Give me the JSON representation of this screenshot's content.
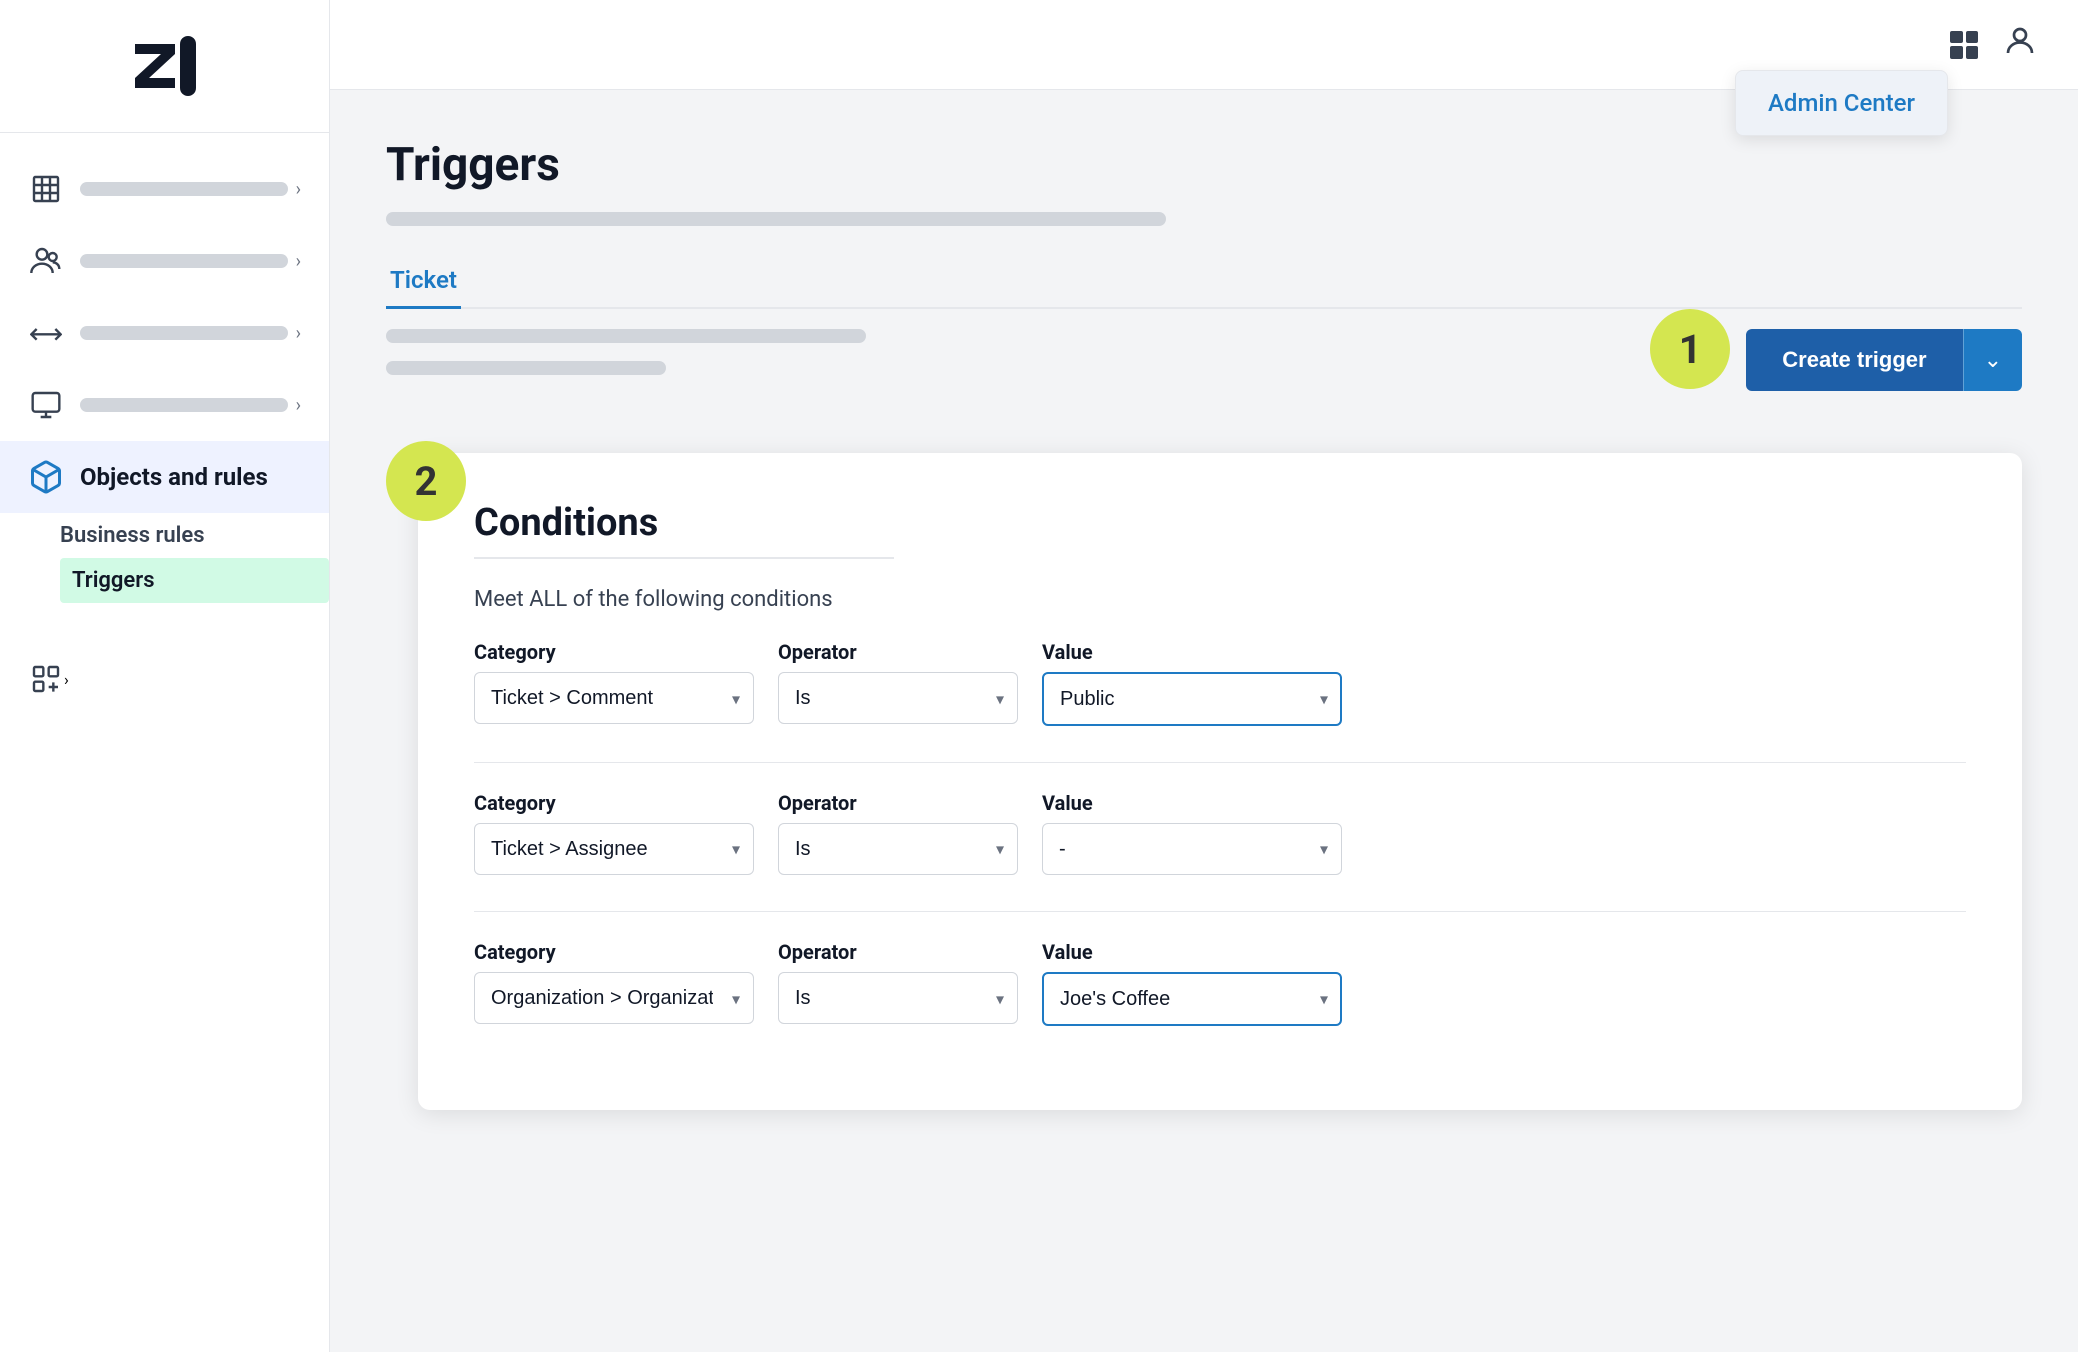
{
  "sidebar": {
    "nav_items": [
      {
        "id": "buildings",
        "icon": "building",
        "active": false
      },
      {
        "id": "people",
        "icon": "people",
        "active": false
      },
      {
        "id": "arrows",
        "icon": "arrows",
        "active": false
      },
      {
        "id": "monitor",
        "icon": "monitor",
        "active": false
      },
      {
        "id": "objects",
        "icon": "objects",
        "label": "Objects and rules",
        "active": true
      },
      {
        "id": "apps",
        "icon": "apps",
        "active": false
      }
    ],
    "objects_rules_label": "Objects and rules",
    "submenu": {
      "business_rules_label": "Business rules",
      "triggers_label": "Triggers"
    }
  },
  "topbar": {
    "grid_icon": "grid",
    "user_icon": "user"
  },
  "admin_dropdown": {
    "label": "Admin Center"
  },
  "page": {
    "title": "Triggers",
    "tab_ticket": "Ticket",
    "step1_number": "1",
    "step2_number": "2",
    "create_trigger_label": "Create trigger",
    "conditions_title": "Conditions",
    "conditions_subtitle_text": "Meet ALL of the following conditions",
    "rows": [
      {
        "category_label": "Category",
        "operator_label": "Operator",
        "value_label": "Value",
        "category_value": "Ticket > Comment",
        "operator_value": "Is",
        "value_value": "Public",
        "value_highlighted": true
      },
      {
        "category_label": "Category",
        "operator_label": "Operator",
        "value_label": "Value",
        "category_value": "Ticket > Assignee",
        "operator_value": "Is",
        "value_value": "-",
        "value_highlighted": false
      },
      {
        "category_label": "Category",
        "operator_label": "Operator",
        "value_label": "Value",
        "category_value": "Organization > Organization",
        "operator_value": "Is",
        "value_value": "Joe's Coffee",
        "value_highlighted": true
      }
    ]
  }
}
